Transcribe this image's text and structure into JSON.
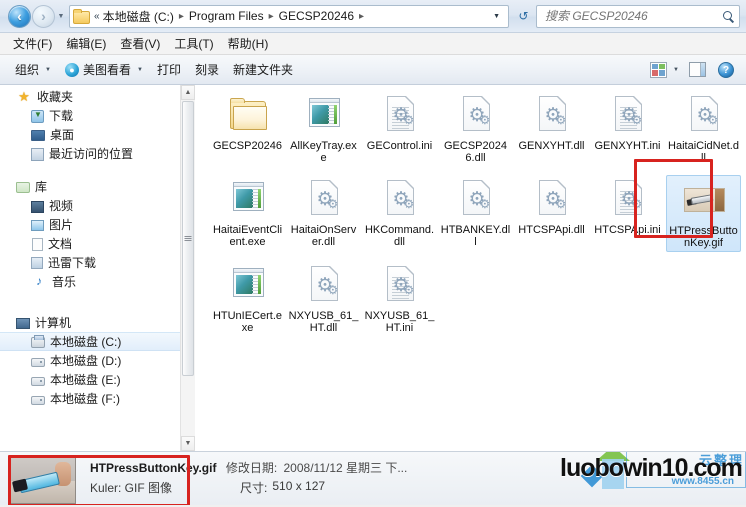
{
  "window": {
    "title": "GECSP20246"
  },
  "address_bar": {
    "back_icon": "back-arrow-icon",
    "forward_icon": "forward-arrow-icon",
    "history_caret": "chevron-down-icon",
    "folder_icon": "folder-icon",
    "overflow": "«",
    "crumbs": [
      "本地磁盘 (C:)",
      "Program Files",
      "GECSP20246"
    ],
    "crumb_separator": "▸",
    "dropdown_caret": "▼",
    "refresh_icon": "refresh-icon",
    "refresh_glyph": "↺"
  },
  "search": {
    "value": "",
    "placeholder": "搜索 GECSP20246",
    "icon": "search-icon"
  },
  "menubar": {
    "items": [
      {
        "label": "文件(F)"
      },
      {
        "label": "编辑(E)"
      },
      {
        "label": "查看(V)"
      },
      {
        "label": "工具(T)"
      },
      {
        "label": "帮助(H)"
      }
    ]
  },
  "toolbar": {
    "organize_label": "组织",
    "meitu_label": "美图看看",
    "meitu_icon": "meitu-icon",
    "print_label": "打印",
    "burn_label": "刻录",
    "new_folder_label": "新建文件夹",
    "caret": "▼",
    "view_icon": "view-layout-icon",
    "preview_pane_icon": "preview-pane-icon",
    "help_icon": "help-icon",
    "help_glyph": "?"
  },
  "sidebar": {
    "groups": [
      {
        "header": {
          "label": "收藏夹",
          "icon": "star-icon",
          "cls": "ico-star",
          "glyph": "★"
        },
        "items": [
          {
            "label": "下载",
            "icon": "downloads-icon",
            "cls": "ico-download"
          },
          {
            "label": "桌面",
            "icon": "desktop-icon",
            "cls": "ico-desktop"
          },
          {
            "label": "最近访问的位置",
            "icon": "recent-places-icon",
            "cls": "ico-recent"
          }
        ]
      },
      {
        "header": {
          "label": "库",
          "icon": "library-icon",
          "cls": "ico-lib",
          "glyph": ""
        },
        "items": [
          {
            "label": "视频",
            "icon": "video-icon",
            "cls": "ico-video"
          },
          {
            "label": "图片",
            "icon": "pictures-icon",
            "cls": "ico-pic"
          },
          {
            "label": "文档",
            "icon": "documents-icon",
            "cls": "ico-doc"
          },
          {
            "label": "迅雷下载",
            "icon": "xunlei-downloads-icon",
            "cls": "ico-xunlei"
          },
          {
            "label": "音乐",
            "icon": "music-icon",
            "cls": "ico-music",
            "glyph": "♪"
          }
        ]
      },
      {
        "header": {
          "label": "计算机",
          "icon": "computer-icon",
          "cls": "ico-computer",
          "glyph": ""
        },
        "items": [
          {
            "label": "本地磁盘 (C:)",
            "icon": "drive-c-icon",
            "cls": "ico-diskc",
            "selected": true
          },
          {
            "label": "本地磁盘 (D:)",
            "icon": "drive-d-icon",
            "cls": "ico-disk"
          },
          {
            "label": "本地磁盘 (E:)",
            "icon": "drive-e-icon",
            "cls": "ico-disk"
          },
          {
            "label": "本地磁盘 (F:)",
            "icon": "drive-f-icon",
            "cls": "ico-disk"
          }
        ]
      }
    ],
    "scrollbar": {
      "up": "▲",
      "down": "▼"
    }
  },
  "files": {
    "rows": [
      [
        {
          "name": "GECSP20246",
          "type": "folder",
          "selected": false
        },
        {
          "name": "AllKeyTray.exe",
          "type": "exe",
          "selected": false
        },
        {
          "name": "GEControl.ini",
          "type": "ini",
          "selected": false
        },
        {
          "name": "GECSP20246.dll",
          "type": "dll",
          "selected": false
        },
        {
          "name": "GENXYHT.dll",
          "type": "dll",
          "selected": false
        },
        {
          "name": "GENXYHT.ini",
          "type": "ini",
          "selected": false
        },
        {
          "name": "HaitaiCidNet.dll",
          "type": "dll",
          "selected": false
        }
      ],
      [
        {
          "name": "HaitaiEventClient.exe",
          "type": "exe",
          "selected": false
        },
        {
          "name": "HaitaiOnServer.dll",
          "type": "dll",
          "selected": false
        },
        {
          "name": "HKCommand.dll",
          "type": "dll",
          "selected": false
        },
        {
          "name": "HTBANKEY.dll",
          "type": "dll",
          "selected": false
        },
        {
          "name": "HTCSPApi.dll",
          "type": "dll",
          "selected": false
        },
        {
          "name": "HTCSPApi.ini",
          "type": "ini",
          "selected": false
        },
        {
          "name": "HTPressButtonKey.gif",
          "type": "gif",
          "selected": true
        }
      ],
      [
        {
          "name": "HTUnIECert.exe",
          "type": "exe",
          "selected": false
        },
        {
          "name": "NXYUSB_61_HT.dll",
          "type": "dll",
          "selected": false
        },
        {
          "name": "NXYUSB_61_HT.ini",
          "type": "ini",
          "selected": false
        }
      ]
    ]
  },
  "details_pane": {
    "file_name": "HTPressButtonKey.gif",
    "modified_label": "修改日期:",
    "modified_value": "2008/11/12 星期三 下...",
    "kind_label": "Kuler: GIF 图像",
    "size_label": "尺寸:",
    "size_value": "510 x 127",
    "thumbnail_icon": "gif-thumbnail"
  },
  "watermark": {
    "main": "luobowin10.com",
    "cn": "云整理",
    "url": "www.8455.cn"
  },
  "annotations": {
    "selected_file_box_color": "#d7231f",
    "thumbnail_box_color": "#d7231f"
  }
}
